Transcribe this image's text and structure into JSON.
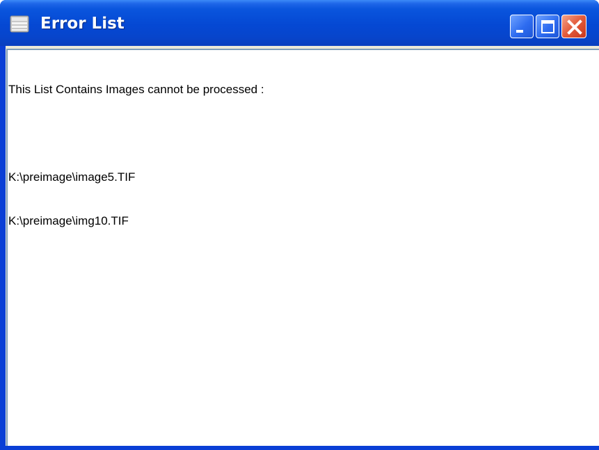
{
  "window": {
    "title": "Error List",
    "icon": "document-list-icon"
  },
  "titlebar_buttons": {
    "minimize": "minimize-icon",
    "maximize": "maximize-icon",
    "close": "close-icon"
  },
  "content": {
    "header": "This List Contains Images cannot be processed :",
    "blank": "",
    "files": [
      "K:\\preimage\\image5.TIF",
      "K:\\preimage\\img10.TIF"
    ]
  },
  "colors": {
    "titlebar": "#0548D3",
    "frame": "#0A3FD6",
    "close_button": "#E35A3A",
    "text": "#000000",
    "background": "#FFFFFF"
  }
}
